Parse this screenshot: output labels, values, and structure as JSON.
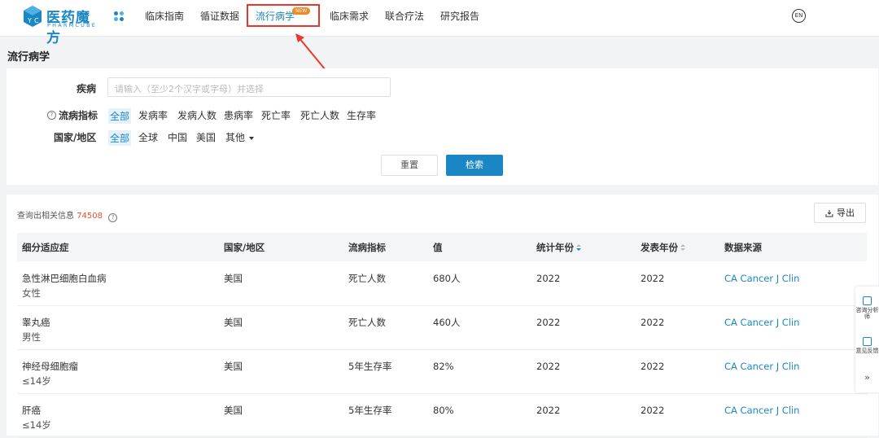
{
  "brand": {
    "name": "医药魔方",
    "sub": "PHARMCUBE"
  },
  "nav": [
    {
      "label": "临床指南"
    },
    {
      "label": "循证数据"
    },
    {
      "label": "流行病学",
      "badge": "NEW"
    },
    {
      "label": "临床需求"
    },
    {
      "label": "联合疗法"
    },
    {
      "label": "研究报告"
    }
  ],
  "lang": "EN",
  "page_title": "流行病学",
  "filters": {
    "disease_label": "疾病",
    "disease_placeholder": "请输入（至少2个汉字或字母）并选择",
    "indicator_label": "流病指标",
    "indicators": [
      "全部",
      "发病率",
      "发病人数",
      "患病率",
      "死亡率",
      "死亡人数",
      "生存率"
    ],
    "region_label": "国家/地区",
    "regions": [
      "全部",
      "全球",
      "中国",
      "美国",
      "其他"
    ],
    "reset": "重置",
    "search": "检索"
  },
  "results": {
    "count_prefix": "查询出相关信息",
    "count": "74508",
    "export": "导出",
    "columns": [
      "细分适应症",
      "国家/地区",
      "流病指标",
      "值",
      "统计年份",
      "发表年份",
      "数据来源"
    ],
    "rows": [
      {
        "indication": "急性淋巴细胞白血病",
        "sub": "女性",
        "region": "美国",
        "indicator": "死亡人数",
        "value": "680人",
        "stat_year": "2022",
        "pub_year": "2022",
        "source": "CA Cancer J Clin"
      },
      {
        "indication": "睾丸癌",
        "sub": "男性",
        "region": "美国",
        "indicator": "死亡人数",
        "value": "460人",
        "stat_year": "2022",
        "pub_year": "2022",
        "source": "CA Cancer J Clin"
      },
      {
        "indication": "神经母细胞瘤",
        "sub": "≤14岁",
        "region": "美国",
        "indicator": "5年生存率",
        "value": "82%",
        "stat_year": "2022",
        "pub_year": "2022",
        "source": "CA Cancer J Clin"
      },
      {
        "indication": "肝癌",
        "sub": "≤14岁",
        "region": "美国",
        "indicator": "5年生存率",
        "value": "80%",
        "stat_year": "2022",
        "pub_year": "2022",
        "source": "CA Cancer J Clin"
      }
    ]
  },
  "side": {
    "consult": "咨询分析师",
    "feedback": "意见反馈",
    "collapse": "»"
  },
  "colors": {
    "accent": "#1b86c4",
    "highlight": "#e8382c",
    "count": "#e8502c"
  }
}
